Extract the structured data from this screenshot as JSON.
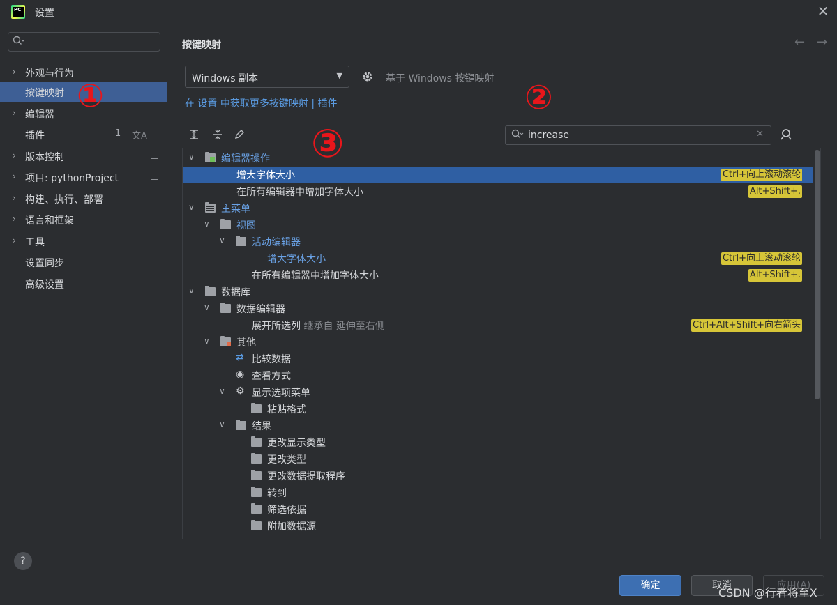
{
  "window": {
    "title": "设置",
    "close": "✕"
  },
  "sidebar": {
    "search_placeholder": "",
    "items": [
      {
        "label": "外观与行为",
        "chevron": "›"
      },
      {
        "label": "按键映射",
        "chevron": ""
      },
      {
        "label": "编辑器",
        "chevron": "›"
      },
      {
        "label": "插件",
        "chevron": "",
        "badge": "1",
        "extra": "文A"
      },
      {
        "label": "版本控制",
        "chevron": "›"
      },
      {
        "label": "项目: pythonProject",
        "chevron": "›"
      },
      {
        "label": "构建、执行、部署",
        "chevron": "›"
      },
      {
        "label": "语言和框架",
        "chevron": "›"
      },
      {
        "label": "工具",
        "chevron": "›"
      },
      {
        "label": "设置同步",
        "chevron": ""
      },
      {
        "label": "高级设置",
        "chevron": ""
      }
    ],
    "help": "?"
  },
  "main": {
    "title": "按键映射",
    "back": "←",
    "forward": "→",
    "keymap_value": "Windows 副本",
    "keymap_based_on": "基于 Windows 按键映射",
    "get_more_link": "在 设置 中获取更多按键映射 | 插件",
    "search_value": "increase",
    "tree": [
      {
        "text": "编辑器操作",
        "expanded": "∨",
        "style": "blue"
      },
      {
        "text": "增大字体大小",
        "style": "white",
        "shortcut": "Ctrl+向上滚动滚轮"
      },
      {
        "text": "在所有编辑器中增加字体大小",
        "shortcut": "Alt+Shift+."
      },
      {
        "text": "主菜单",
        "expanded": "∨",
        "style": "blue"
      },
      {
        "text": "视图",
        "expanded": "∨",
        "style": "blue"
      },
      {
        "text": "活动编辑器",
        "expanded": "∨",
        "style": "blue"
      },
      {
        "text": "增大字体大小",
        "style": "blue",
        "shortcut": "Ctrl+向上滚动滚轮"
      },
      {
        "text": "在所有编辑器中增加字体大小",
        "shortcut": "Alt+Shift+."
      },
      {
        "text": "数据库",
        "expanded": "∨"
      },
      {
        "text": "数据编辑器",
        "expanded": "∨"
      },
      {
        "text": "展开所选列",
        "inherit_prefix": "继承自",
        "inherit_link": "延伸至右侧",
        "shortcut": "Ctrl+Alt+Shift+向右箭头"
      },
      {
        "text": "其他",
        "expanded": "∨"
      },
      {
        "text": "比较数据"
      },
      {
        "text": "查看方式"
      },
      {
        "text": "显示选项菜单",
        "expanded": "∨"
      },
      {
        "text": "粘贴格式"
      },
      {
        "text": "结果",
        "expanded": "∨"
      },
      {
        "text": "更改显示类型"
      },
      {
        "text": "更改类型"
      },
      {
        "text": "更改数据提取程序"
      },
      {
        "text": "转到"
      },
      {
        "text": "筛选依据"
      },
      {
        "text": "附加数据源"
      }
    ]
  },
  "buttons": {
    "ok": "确定",
    "cancel": "取消",
    "apply": "应用(A)"
  },
  "annotations": [
    "①",
    "②",
    "③"
  ],
  "watermark": "CSDN @行者将至X",
  "colors": {
    "accent": "#3e5f95",
    "selected_row": "#2f5fa3",
    "shortcut_bg": "#d6c538",
    "link": "#5a9ae0",
    "annotation": "#e8161b"
  }
}
